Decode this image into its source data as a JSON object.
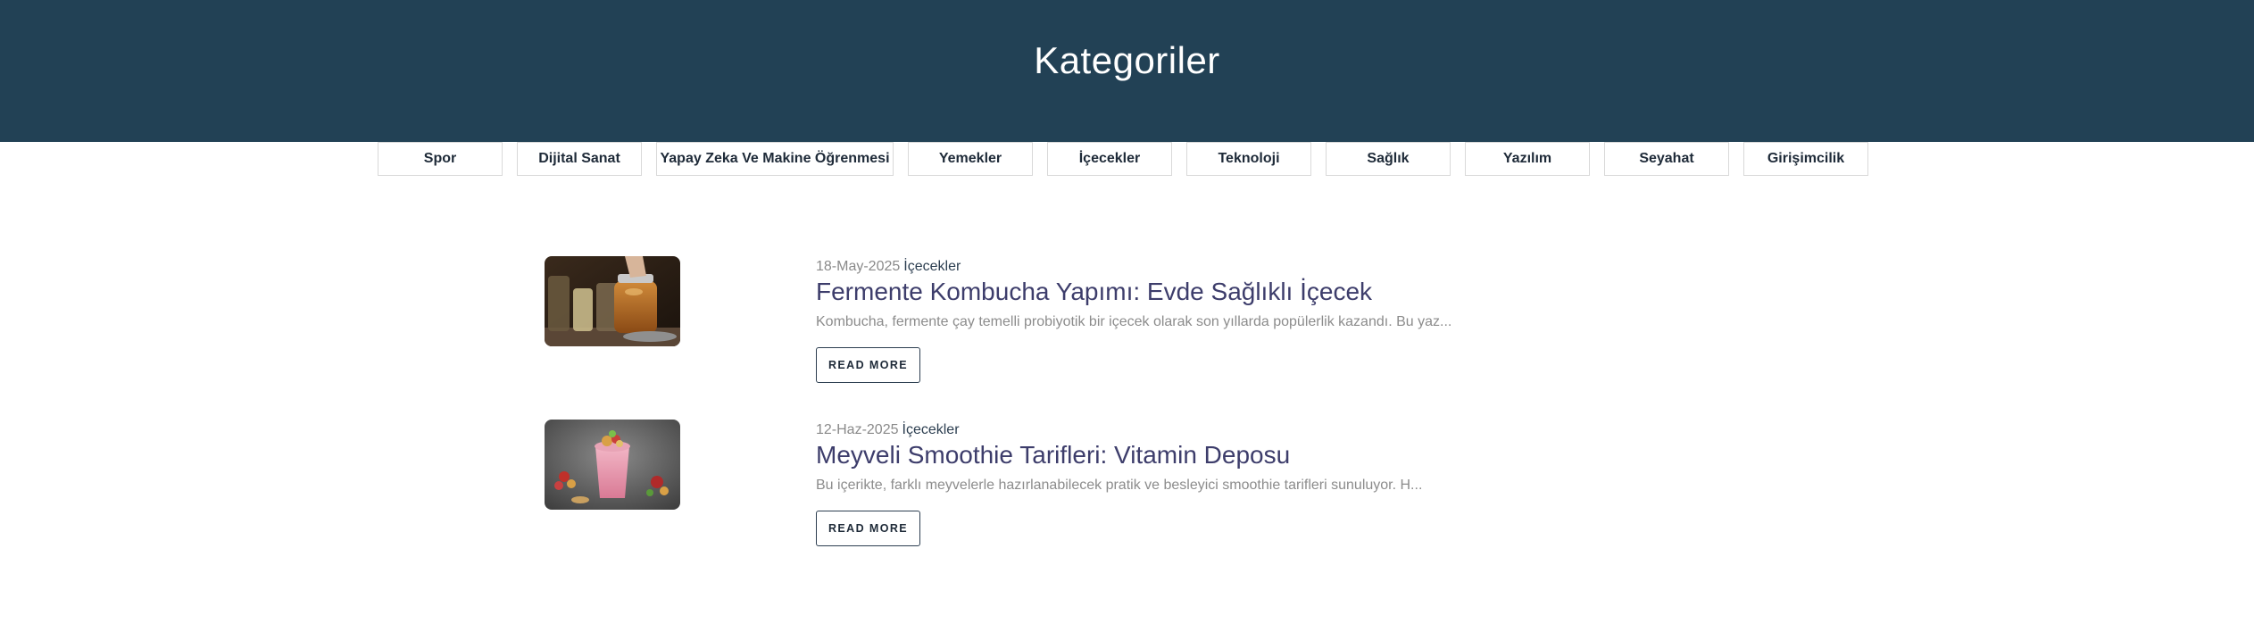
{
  "hero": {
    "title": "Kategoriler"
  },
  "categories": [
    "Spor",
    "Dijital Sanat",
    "Yapay Zeka Ve Makine Öğrenmesi",
    "Yemekler",
    "İçecekler",
    "Teknoloji",
    "Sağlık",
    "Yazılım",
    "Seyahat",
    "Girişimcilik"
  ],
  "posts": [
    {
      "date": "18-May-2025",
      "category": "İçecekler",
      "title": "Fermente Kombucha Yapımı: Evde Sağlıklı İçecek",
      "excerpt": "Kombucha, fermente çay temelli probiyotik bir içecek olarak son yıllarda popülerlik kazandı. Bu yaz...",
      "button": "READ MORE",
      "image": "kombucha-jars-image"
    },
    {
      "date": "12-Haz-2025",
      "category": "İçecekler",
      "title": "Meyveli Smoothie Tarifleri: Vitamin Deposu",
      "excerpt": "Bu içerikte, farklı meyvelerle hazırlanabilecek pratik ve besleyici smoothie tarifleri sunuluyor. H...",
      "button": "READ MORE",
      "image": "berry-smoothie-image"
    }
  ]
}
